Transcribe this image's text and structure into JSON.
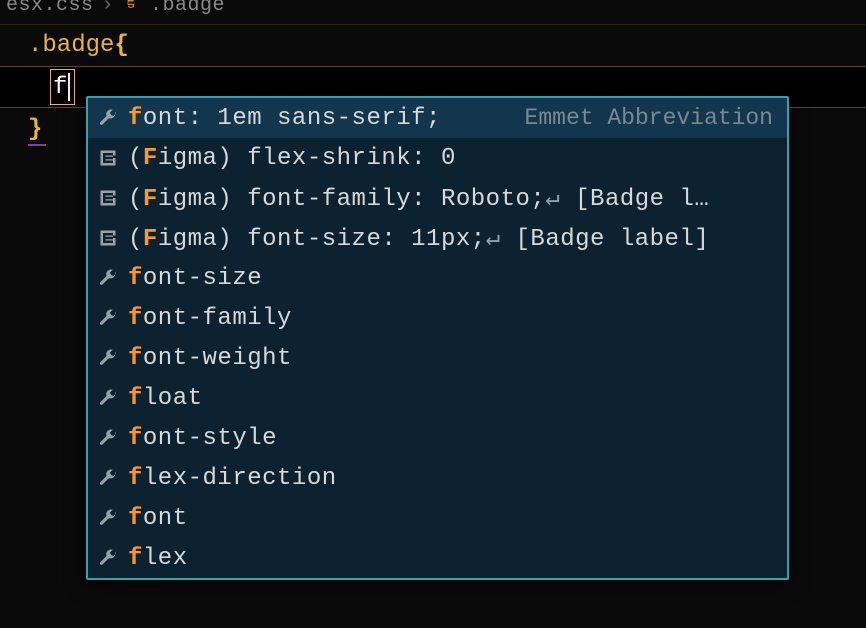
{
  "breadcrumb": {
    "file": "esx.css",
    "symbol": ".badge"
  },
  "code": {
    "selector": ".badge",
    "open_brace": "{",
    "close_brace": "}",
    "typed": "f"
  },
  "suggestions": {
    "hint_label": "Emmet Abbreviation",
    "items": [
      {
        "icon": "wrench",
        "pre": "f",
        "rest": "ont: 1em sans-serif;",
        "hint": true
      },
      {
        "icon": "snippet",
        "pre": "(F",
        "rest": "igma) flex-shrink: 0"
      },
      {
        "icon": "snippet",
        "pre": "(F",
        "rest": "igma) font-family: Roboto;",
        "ret": true,
        "tail": " [Badge l…"
      },
      {
        "icon": "snippet",
        "pre": "(F",
        "rest": "igma) font-size: 11px;",
        "ret": true,
        "tail": " [Badge label]"
      },
      {
        "icon": "wrench",
        "pre": "f",
        "rest": "ont-size"
      },
      {
        "icon": "wrench",
        "pre": "f",
        "rest": "ont-family"
      },
      {
        "icon": "wrench",
        "pre": "f",
        "rest": "ont-weight"
      },
      {
        "icon": "wrench",
        "pre": "f",
        "rest": "loat"
      },
      {
        "icon": "wrench",
        "pre": "f",
        "rest": "ont-style"
      },
      {
        "icon": "wrench",
        "pre": "f",
        "rest": "lex-direction"
      },
      {
        "icon": "wrench",
        "pre": "f",
        "rest": "ont"
      },
      {
        "icon": "wrench",
        "pre": "f",
        "rest": "lex"
      }
    ]
  }
}
